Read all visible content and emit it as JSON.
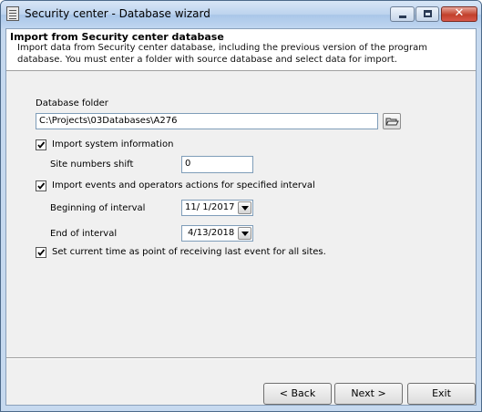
{
  "window": {
    "title": "Security center - Database wizard",
    "close_glyph": "✕"
  },
  "header": {
    "title": "Import from Security center database",
    "description": "Import data from Security center database, including the previous version of the program database. You must enter a folder with source database and select data for import."
  },
  "form": {
    "database_folder_label": "Database folder",
    "database_folder_value": "C:\\Projects\\03Databases\\A276",
    "import_system_info": {
      "label": "Import system information",
      "checked": true
    },
    "site_numbers_shift": {
      "label": "Site numbers shift",
      "value": "0"
    },
    "import_events": {
      "label": "Import events and operators actions for specified interval",
      "checked": true
    },
    "beginning_of_interval": {
      "label": "Beginning of interval",
      "value": "11/ 1/2017"
    },
    "end_of_interval": {
      "label": "End of interval",
      "value": "4/13/2018"
    },
    "set_current_time": {
      "label": "Set current time as point of receiving last event for all sites.",
      "checked": true
    }
  },
  "buttons": {
    "back": "< Back",
    "next": "Next >",
    "exit": "Exit"
  },
  "icons": {
    "app": "database-wizard-icon",
    "browse": "open-folder-icon",
    "dropdown": "chevron-down-icon",
    "check": "check-icon"
  }
}
